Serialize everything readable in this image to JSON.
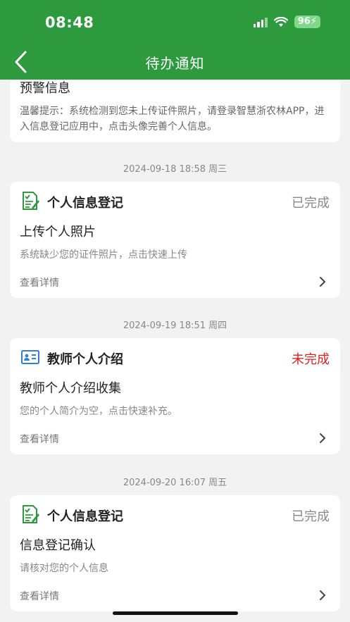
{
  "status_bar": {
    "time": "08:48",
    "battery": "96"
  },
  "header": {
    "title": "待办通知"
  },
  "warning": {
    "title": "预警信息",
    "text": "温馨提示：系统检测到您未上传证件照片，请登录智慧浙农林APP，进入信息登记应用中，点击头像完善个人信息。"
  },
  "notices": [
    {
      "timestamp": "2024-09-18 18:58 周三",
      "icon": "document-check-icon",
      "title": "个人信息登记",
      "status": "已完成",
      "subject": "上传个人照片",
      "desc": "系统缺少您的证件照片，点击快速上传",
      "detail": "查看详情"
    },
    {
      "timestamp": "2024-09-19 18:51 周四",
      "icon": "id-card-icon",
      "title": "教师个人介绍",
      "status": "未完成",
      "subject": "教师个人介绍收集",
      "desc": "您的个人简介为空，点击快速补充。",
      "detail": "查看详情"
    },
    {
      "timestamp": "2024-09-20 16:07 周五",
      "icon": "document-check-icon",
      "title": "个人信息登记",
      "status": "已完成",
      "subject": "信息登记确认",
      "desc": "请核对您的个人信息",
      "detail": "查看详情"
    }
  ],
  "colors": {
    "header_bg": "#2e9a3e",
    "status_done": "#888888",
    "status_todo": "#e02020",
    "id_icon": "#2f7fd8"
  }
}
